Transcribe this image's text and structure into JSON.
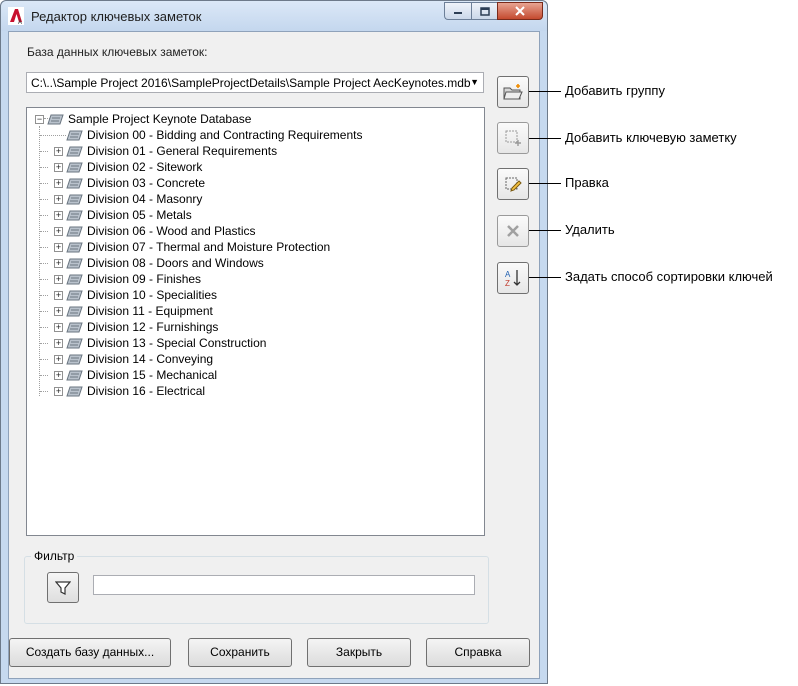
{
  "window": {
    "title": "Редактор ключевых заметок"
  },
  "database": {
    "label": "База данных ключевых заметок:",
    "path": "C:\\..\\Sample Project 2016\\SampleProjectDetails\\Sample Project AecKeynotes.mdb"
  },
  "tree": {
    "root": "Sample Project Keynote Database",
    "items": [
      "Division 00 - Bidding and Contracting Requirements",
      "Division 01 - General Requirements",
      "Division 02 - Sitework",
      "Division 03 - Concrete",
      "Division 04 - Masonry",
      "Division 05 - Metals",
      "Division 06 - Wood and Plastics",
      "Division 07 - Thermal and Moisture Protection",
      "Division 08 - Doors and Windows",
      "Division 09 - Finishes",
      "Division 10 - Specialities",
      "Division 11 - Equipment",
      "Division 12 - Furnishings",
      "Division 13 - Special Construction",
      "Division 14 - Conveying",
      "Division 15 - Mechanical",
      "Division 16 - Electrical"
    ]
  },
  "filter": {
    "label": "Фильтр",
    "value": ""
  },
  "buttons": {
    "create_db": "Создать базу данных...",
    "save": "Сохранить",
    "close": "Закрыть",
    "help": "Справка"
  },
  "callouts": {
    "add_group": "Добавить группу",
    "add_keynote": "Добавить ключевую заметку",
    "edit": "Правка",
    "delete": "Удалить",
    "sort": "Задать способ сортировки ключей"
  }
}
